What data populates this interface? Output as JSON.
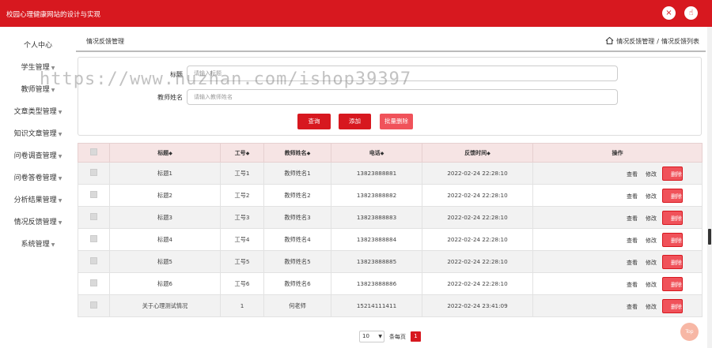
{
  "app": {
    "title": "校园心理健康网站的设计与实现"
  },
  "topbar": {
    "close_icon": "×",
    "user_icon": "☝"
  },
  "sidebar": {
    "items": [
      {
        "label": "个人中心",
        "caret": false
      },
      {
        "label": "学生管理",
        "caret": true
      },
      {
        "label": "教师管理",
        "caret": true
      },
      {
        "label": "文章类型管理",
        "caret": true
      },
      {
        "label": "知识文章管理",
        "caret": true
      },
      {
        "label": "问卷调查管理",
        "caret": true
      },
      {
        "label": "问卷答卷管理",
        "caret": true
      },
      {
        "label": "分析结果管理",
        "caret": true
      },
      {
        "label": "情况反馈管理",
        "caret": true
      },
      {
        "label": "系统管理",
        "caret": true
      }
    ],
    "caret_glyph": "▼"
  },
  "breadcrumb": {
    "title": "情况反馈管理",
    "path1": "情况反馈管理",
    "sep": "/",
    "path2": "情况反馈列表"
  },
  "search": {
    "title_label": "标题",
    "title_placeholder": "请输入标题",
    "teacher_label": "教师姓名",
    "teacher_placeholder": "请输入教师姓名",
    "query_button": "查询",
    "add_button": "添加",
    "batch_delete_button": "批量删除"
  },
  "watermark": "https://www.huzhan.com/ishop39397",
  "table": {
    "headers": [
      "",
      "标题",
      "工号",
      "教师姓名",
      "电话",
      "反馈时间",
      "操作"
    ],
    "sortable": [
      false,
      true,
      true,
      true,
      true,
      true,
      false
    ],
    "sort_glyph": "◆",
    "rows": [
      {
        "title": "标题1",
        "job_no": "工号1",
        "teacher": "教师姓名1",
        "phone": "13823888881",
        "time": "2022-02-24 22:28:10"
      },
      {
        "title": "标题2",
        "job_no": "工号2",
        "teacher": "教师姓名2",
        "phone": "13823888882",
        "time": "2022-02-24 22:28:10"
      },
      {
        "title": "标题3",
        "job_no": "工号3",
        "teacher": "教师姓名3",
        "phone": "13823888883",
        "time": "2022-02-24 22:28:10"
      },
      {
        "title": "标题4",
        "job_no": "工号4",
        "teacher": "教师姓名4",
        "phone": "13823888884",
        "time": "2022-02-24 22:28:10"
      },
      {
        "title": "标题5",
        "job_no": "工号5",
        "teacher": "教师姓名5",
        "phone": "13823888885",
        "time": "2022-02-24 22:28:10"
      },
      {
        "title": "标题6",
        "job_no": "工号6",
        "teacher": "教师姓名6",
        "phone": "13823888886",
        "time": "2022-02-24 22:28:10"
      },
      {
        "title": "关于心理测试情况",
        "job_no": "1",
        "teacher": "何老师",
        "phone": "15214111411",
        "time": "2022-02-24 23:41:09"
      }
    ],
    "actions": {
      "view": "查看",
      "edit": "修改",
      "delete": "删除"
    }
  },
  "pagination": {
    "page_size": "10",
    "per_page_label": "条每页",
    "current_page": "1"
  },
  "back_to_top": "Top",
  "colors": {
    "primary": "#d7181f",
    "delete": "#f0525a",
    "header_bg": "#f6e4e4"
  }
}
